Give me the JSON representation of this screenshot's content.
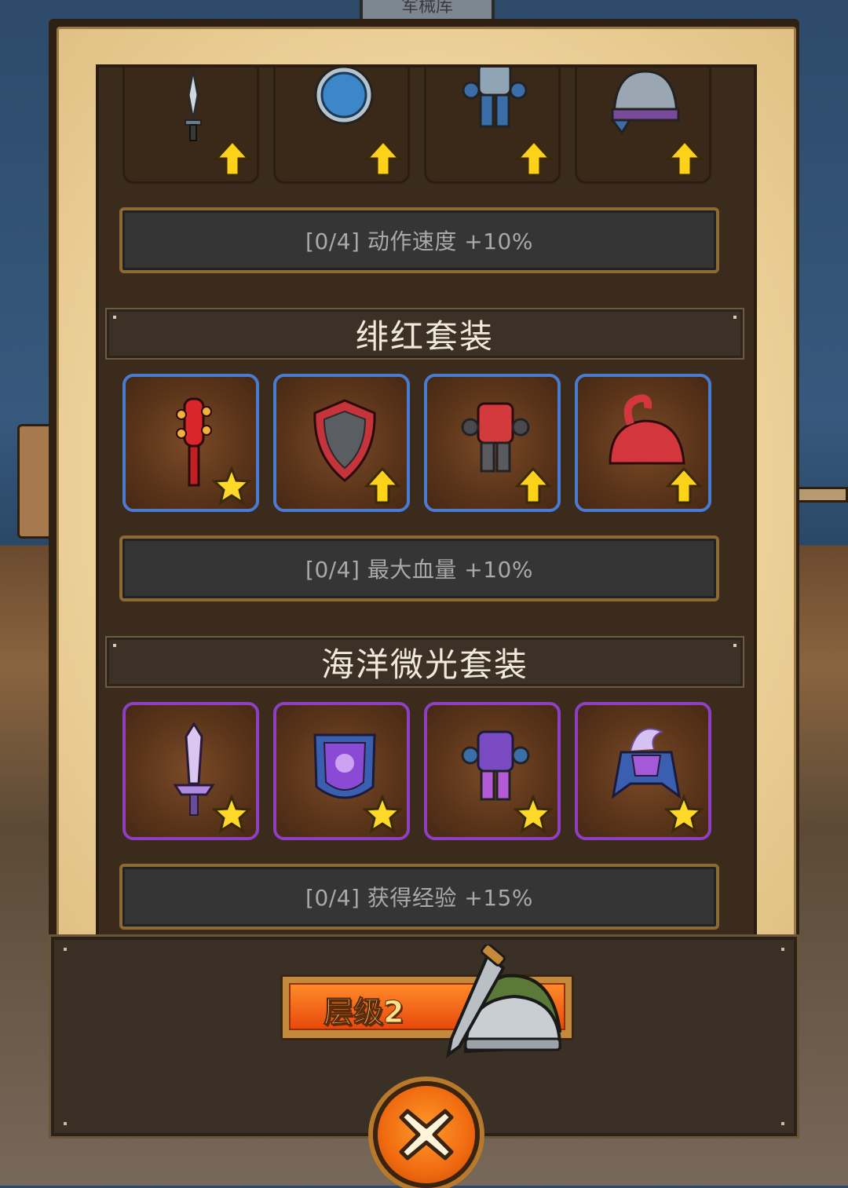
{
  "header_tab": {
    "label": "军械库"
  },
  "sets": [
    {
      "id": "first",
      "title": "",
      "items": [
        {
          "icon": "dagger-icon",
          "badge": "upgrade-arrow-icon",
          "rarity": "plain"
        },
        {
          "icon": "round-shield-icon",
          "badge": "upgrade-arrow-icon",
          "rarity": "plain"
        },
        {
          "icon": "armor-icon",
          "badge": "upgrade-arrow-icon",
          "rarity": "plain"
        },
        {
          "icon": "helmet-icon",
          "badge": "upgrade-arrow-icon",
          "rarity": "plain"
        }
      ],
      "bonus": "[0/4] 动作速度 +10%"
    },
    {
      "id": "crimson",
      "title": "绯红套装",
      "items": [
        {
          "icon": "spiked-mace-icon",
          "badge": "star-icon",
          "rarity": "rare"
        },
        {
          "icon": "shield-icon",
          "badge": "upgrade-arrow-icon",
          "rarity": "rare"
        },
        {
          "icon": "armor-icon",
          "badge": "upgrade-arrow-icon",
          "rarity": "rare"
        },
        {
          "icon": "helmet-icon",
          "badge": "upgrade-arrow-icon",
          "rarity": "rare"
        }
      ],
      "bonus": "[0/4] 最大血量 +10%"
    },
    {
      "id": "ocean",
      "title": "海洋微光套装",
      "items": [
        {
          "icon": "sword-icon",
          "badge": "star-icon",
          "rarity": "epic"
        },
        {
          "icon": "shield-icon",
          "badge": "star-icon",
          "rarity": "epic"
        },
        {
          "icon": "armor-icon",
          "badge": "star-icon",
          "rarity": "epic"
        },
        {
          "icon": "helmet-icon",
          "badge": "star-icon",
          "rarity": "epic"
        }
      ],
      "bonus": "[0/4] 获得经验 +15%"
    }
  ],
  "tier": {
    "label": "层级2"
  },
  "colors": {
    "rare_border": "#4a7bd3",
    "epic_border": "#8e3fc2",
    "accent_orange": "#f06a10"
  }
}
